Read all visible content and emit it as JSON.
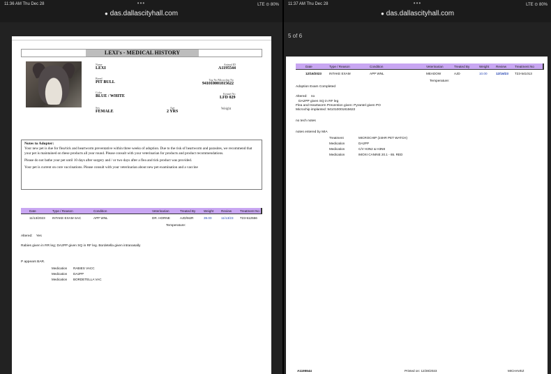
{
  "left": {
    "status": {
      "time": "11:36 AM  Thu Dec 28",
      "signal": "LTE ⊙ 80%"
    },
    "url": "das.dallascityhall.com",
    "title": "LEXI's - MEDICAL HISTORY",
    "pet": {
      "name_label": "Name",
      "name": "LEXI",
      "breed_label": "Breed",
      "breed": "PIT BULL",
      "color_label": "Color",
      "color": "BLUE / WHITE",
      "sex_label": "Sex",
      "sex": "FEMALE",
      "age_label": "Age",
      "age": "2 YRS",
      "animal_id_label": "Animal ID",
      "animal_id": "A1195544",
      "tag_label": "Tag No/Microchip No",
      "tag": "941010001815622",
      "kennel_label": "Kennel No",
      "kennel": "LFD 029",
      "weight_label": "Weight"
    },
    "notes": {
      "title": "Notes to Adopter:",
      "p1": "Your new pet is due for flea/tick and heartworm preventative within three weeks of adoption. Due to the risk of heartworm and parasites, we recommend that your pet is maintained on these products all year round. Please consult with your veterinarian for products and product recommendations.",
      "p2": "Please do not bathe your pet until 10 days after surgery and / or two days after a flea and tick product was provided.",
      "p3": "Your pet is current on core vaccinations. Please consult with your veterinarian about new pet examination and a vaccine"
    },
    "table_headers": [
      "Date",
      "Type / Reason",
      "Condition",
      "Veterinarian",
      "Treated By",
      "Weight",
      "Review",
      "Treatment No"
    ],
    "row": [
      "11/13/2023",
      "INTAKE EXAM SAC",
      "APP WNL",
      "DR. HORNE",
      "AJD/MJR",
      "39.00",
      "11/13/23",
      "T23-512556"
    ],
    "temperature_label": "Temperature:",
    "altered_label": "Altered:",
    "altered_value": "Yes",
    "vacc_note": "Rabies given in RR leg; DA2PP given SQ in RF leg. Bordetella given intranasally",
    "bar_note": "P appears BAR.",
    "meds": [
      {
        "type": "Medication",
        "name": "RABIES VACC"
      },
      {
        "type": "Medication",
        "name": "DA2PP"
      },
      {
        "type": "Medication",
        "name": "BORDETELLA VAC"
      }
    ]
  },
  "right": {
    "status": {
      "time": "11:37 AM  Thu Dec 28",
      "signal": "LTE ⊙ 80%"
    },
    "url": "das.dallascityhall.com",
    "page_count": "5 of 6",
    "table_headers": [
      "Date",
      "Type / Reason",
      "Condition",
      "Veterinarian",
      "Treated By",
      "Weight",
      "Review",
      "Treatment No"
    ],
    "row": [
      "12/16/2023",
      "INTAKE EXAM",
      "APP WNL",
      "MEADOW",
      "AJD",
      "10.00",
      "12/16/23",
      "T23-541013"
    ],
    "exam_note": "Adoption Exam Completed",
    "temperature_label": "Temperature:",
    "altered_label": "Altered:",
    "altered_value": "no",
    "lines": [
      "DA2PP given SQ in RF leg",
      "Flea and Heartworm Prevention given: Pyrantel given PO",
      "Microchip implanted: 941010001815622"
    ],
    "no_tech": "no tech notes",
    "notes_by": "notes entered by MIA",
    "treatments": [
      {
        "type": "Treatment",
        "name": "MICROCHIP (24HR PET WATCH)"
      },
      {
        "type": "Medication",
        "name": "DA2PP"
      },
      {
        "type": "Medication",
        "name": "C/V H3N2 & H3N8"
      },
      {
        "type": "Medication",
        "name": "IMOXI CANINE 20.1 - 65. RED"
      }
    ],
    "footer": [
      "A1195544",
      "Printed on: 12/28/2023",
      "MICHAVEZ"
    ]
  }
}
